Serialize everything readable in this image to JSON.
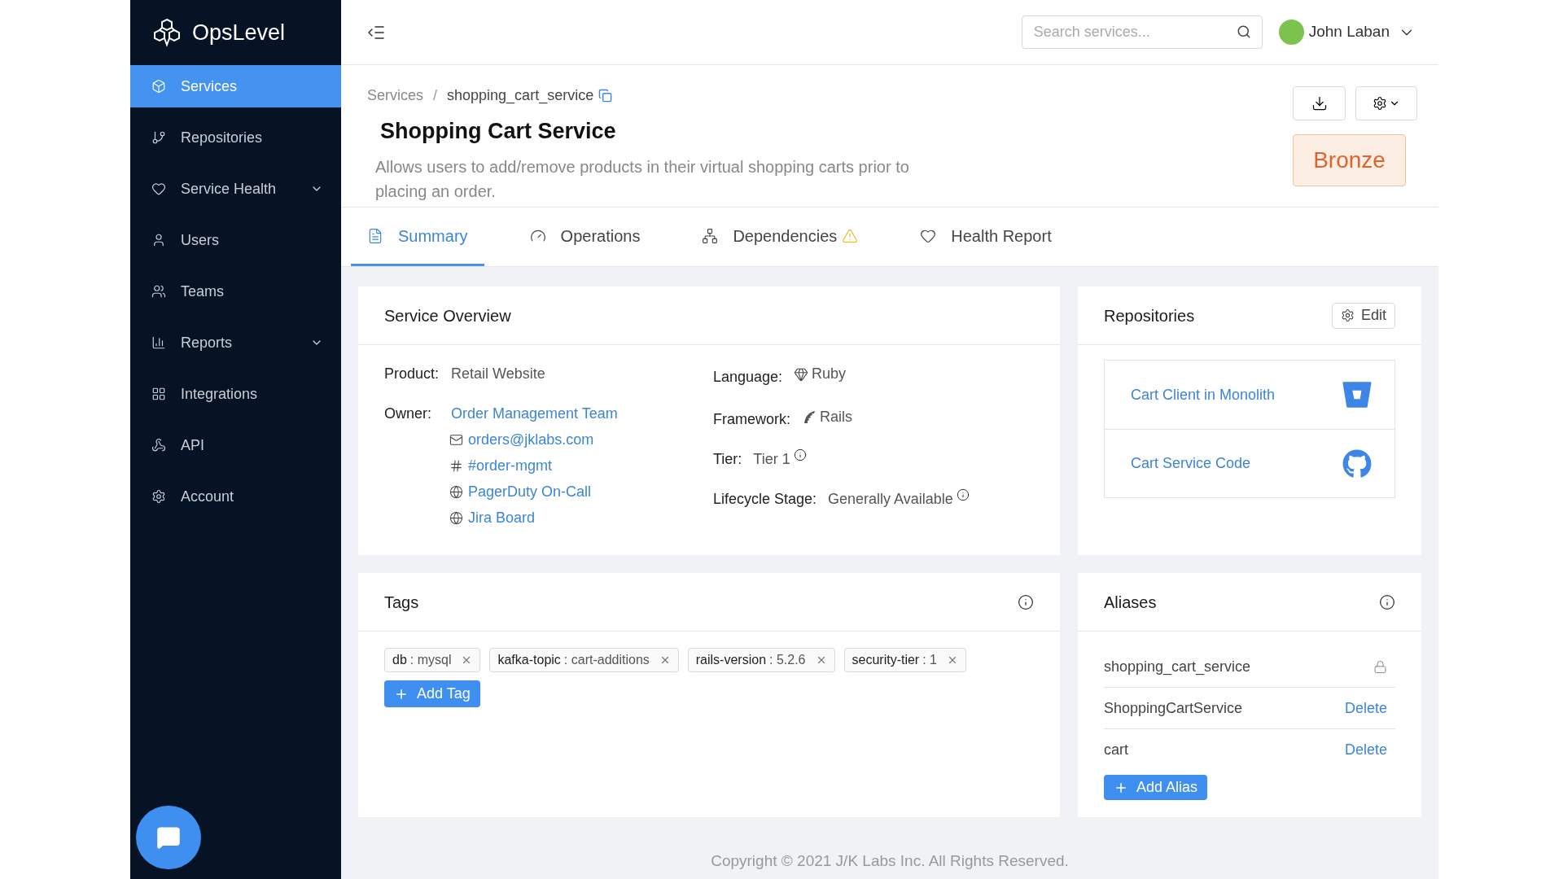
{
  "brand": {
    "name": "OpsLevel"
  },
  "sidebar": {
    "items": [
      {
        "label": "Services",
        "selected": true,
        "expandable": false
      },
      {
        "label": "Repositories",
        "selected": false,
        "expandable": false
      },
      {
        "label": "Service Health",
        "selected": false,
        "expandable": true
      },
      {
        "label": "Users",
        "selected": false,
        "expandable": false
      },
      {
        "label": "Teams",
        "selected": false,
        "expandable": false
      },
      {
        "label": "Reports",
        "selected": false,
        "expandable": true
      },
      {
        "label": "Integrations",
        "selected": false,
        "expandable": false
      },
      {
        "label": "API",
        "selected": false,
        "expandable": false
      },
      {
        "label": "Account",
        "selected": false,
        "expandable": false
      }
    ]
  },
  "header": {
    "search": {
      "placeholder": "Search services..."
    },
    "user": {
      "name": "John Laban"
    }
  },
  "breadcrumb": {
    "parent": "Services",
    "separator": "/",
    "current": "shopping_cart_service"
  },
  "service": {
    "title": "Shopping Cart Service",
    "description": "Allows users to add/remove products in their virtual shopping carts prior to placing an order.",
    "level": "Bronze"
  },
  "tabs": [
    {
      "label": "Summary",
      "selected": true,
      "warning": false
    },
    {
      "label": "Operations",
      "selected": false,
      "warning": false
    },
    {
      "label": "Dependencies",
      "selected": false,
      "warning": true
    },
    {
      "label": "Health Report",
      "selected": false,
      "warning": false
    }
  ],
  "overview": {
    "title": "Service Overview",
    "left": [
      {
        "label": "Product:",
        "value": "Retail Website",
        "kind": "plain"
      },
      {
        "label": "Owner:",
        "value": "Order Management Team",
        "kind": "link",
        "contacts": [
          {
            "kind": "email",
            "text": "orders@jklabs.com"
          },
          {
            "kind": "chat",
            "text": "#order-mgmt"
          },
          {
            "kind": "web",
            "text": "PagerDuty On-Call"
          },
          {
            "kind": "web",
            "text": "Jira Board"
          }
        ]
      }
    ],
    "right": [
      {
        "label": "Language:",
        "value": "Ruby",
        "kind": "ruby"
      },
      {
        "label": "Framework:",
        "value": "Rails",
        "kind": "rails"
      },
      {
        "label": "Tier:",
        "value": "Tier 1",
        "kind": "info"
      },
      {
        "label": "Lifecycle Stage:",
        "value": "Generally Available",
        "kind": "info"
      }
    ]
  },
  "repositories": {
    "title": "Repositories",
    "edit": "Edit",
    "items": [
      {
        "name": "Cart Client in Monolith",
        "kind": "bucket"
      },
      {
        "name": "Cart Service Code",
        "kind": "octocat"
      }
    ]
  },
  "tags": {
    "title": "Tags",
    "items": [
      {
        "key": "db",
        "value": ": mysql"
      },
      {
        "key": "kafka-topic",
        "value": ": cart-additions"
      },
      {
        "key": "rails-version",
        "value": ": 5.2.6"
      },
      {
        "key": "security-tier",
        "value": ": 1"
      }
    ],
    "add": "Add Tag"
  },
  "aliases": {
    "title": "Aliases",
    "items": [
      {
        "name": "shopping_cart_service",
        "locked": true
      },
      {
        "name": "ShoppingCartService",
        "locked": false,
        "action": "Delete"
      },
      {
        "name": "cart",
        "locked": false,
        "action": "Delete"
      }
    ],
    "add": "Add Alias"
  },
  "footer": "Copyright © 2021 J/K Labs Inc. All Rights Reserved."
}
